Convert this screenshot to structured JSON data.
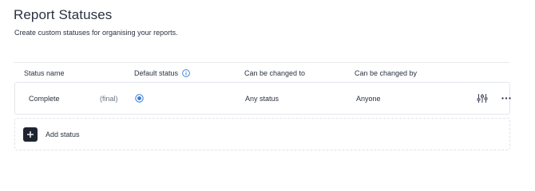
{
  "page": {
    "title": "Report Statuses",
    "subtitle": "Create custom statuses for organising your reports."
  },
  "table": {
    "columns": {
      "status_name": "Status name",
      "default_status": "Default status",
      "can_be_changed_to": "Can be changed to",
      "can_be_changed_by": "Can be changed by"
    },
    "rows": [
      {
        "name": "Complete",
        "tag": "(final)",
        "is_default": true,
        "changed_to": "Any status",
        "changed_by": "Anyone"
      }
    ]
  },
  "add_status": {
    "label": "Add status"
  },
  "icons": {
    "info": "info-icon",
    "radio": "radio-selected-icon",
    "settings": "sliders-icon",
    "more": "more-horizontal-icon",
    "add": "plus-icon"
  },
  "colors": {
    "accent": "#2f7ad6",
    "dark": "#1f2430",
    "border": "#e3e6eb"
  }
}
